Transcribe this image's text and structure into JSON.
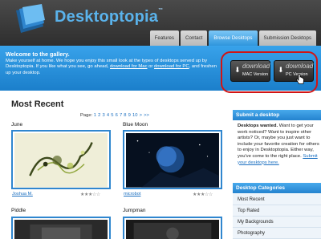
{
  "app": {
    "logo_text": "Desktoptopia",
    "logo_tm": "™"
  },
  "nav": {
    "tabs": [
      {
        "label": "Features"
      },
      {
        "label": "Contact"
      },
      {
        "label": "Browse Desktops"
      },
      {
        "label": "Submission Desktops"
      }
    ],
    "active_tab": "Browse Desktops"
  },
  "banner": {
    "title": "Welcome to the gallery.",
    "text_1": "Make yourself at home. We hope you enjoy this small look at the types of desktops served up by Desktoptopia. If you like what you see, go ahead,",
    "link_mac": "download for Mac",
    "text_or": " or ",
    "link_pc": "download for PC",
    "text_2": ", and freshen up your desktop."
  },
  "downloads": {
    "mac": {
      "word": "download",
      "sub": "MAC Version"
    },
    "pc": {
      "word": "download",
      "sub": "PC Version"
    }
  },
  "main": {
    "title": "Most Recent",
    "pager_label": "Page:",
    "pages": [
      "1",
      "2",
      "3",
      "4",
      "5",
      "6",
      "7",
      "8",
      "9",
      "10"
    ],
    "pager_next": ">",
    "pager_last": ">>"
  },
  "cards": [
    {
      "title": "June",
      "author": "Joshua M.",
      "stars": "★★★☆☆"
    },
    {
      "title": "Blue Moon",
      "author": "microbot",
      "stars": "★★★☆☆"
    },
    {
      "title": "Piddle",
      "author": "",
      "stars": ""
    },
    {
      "title": "Jumpman",
      "author": "",
      "stars": ""
    }
  ],
  "sidebar": {
    "submit_head": "Submit a desktop",
    "submit_text_bold": "Desktops wanted.",
    "submit_text": " Want to get your work noticed? Want to inspire other artists? Or, maybe you just want to include your favorite creation for others to enjoy in Desktoptopia. Either way, you've come to the right place.",
    "submit_link": "Submit your desktops here.",
    "categories_head": "Desktop Categories",
    "categories": [
      "Most Recent",
      "Top Rated",
      "My Backgrounds",
      "Photography"
    ]
  },
  "colors": {
    "accent_blue": "#2f95dc",
    "header_dark": "#353535",
    "highlight_red": "#d11414"
  }
}
